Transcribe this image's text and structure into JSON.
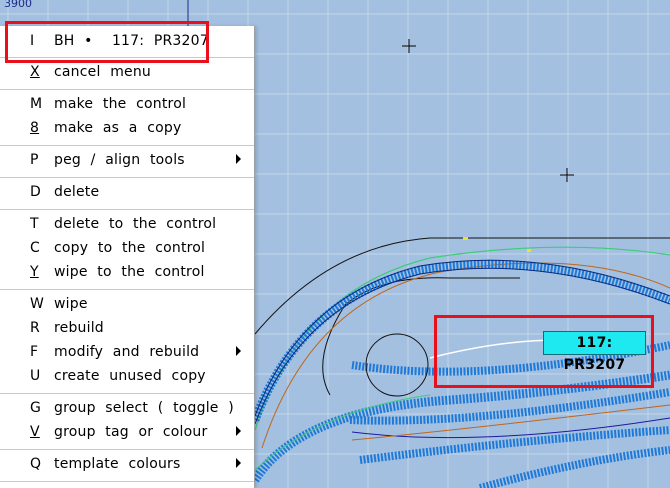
{
  "canvas": {
    "axis_label": "3900",
    "colors": {
      "background": "#a4c0e0",
      "grid": "#c4d6ea",
      "track_blue": "#1565c0",
      "highlight": "#e8101a"
    }
  },
  "menu": {
    "header": {
      "key": "I",
      "label": "BH •  117: PR3207"
    },
    "items": [
      {
        "key": "X",
        "label": "cancel menu"
      },
      {
        "key": "M",
        "label": "make the control"
      },
      {
        "key": "8",
        "label": "make as a copy"
      },
      {
        "key": "P",
        "label": "peg / align tools",
        "submenu": true
      },
      {
        "key": "D",
        "label": "delete"
      },
      {
        "key": "T",
        "label": "delete to the control"
      },
      {
        "key": "C",
        "label": "copy to the control"
      },
      {
        "key": "Y",
        "label": "wipe to the control"
      },
      {
        "key": "W",
        "label": "wipe"
      },
      {
        "key": "R",
        "label": "rebuild"
      },
      {
        "key": "F",
        "label": "modify and rebuild",
        "submenu": true
      },
      {
        "key": "U",
        "label": "create unused copy"
      },
      {
        "key": "G",
        "label": "group select ( toggle )"
      },
      {
        "key": "V",
        "label": "group tag or colour",
        "submenu": true
      },
      {
        "key": "Q",
        "label": "template colours",
        "submenu": true
      }
    ]
  },
  "track_tag": {
    "label": "117: PR3207"
  }
}
